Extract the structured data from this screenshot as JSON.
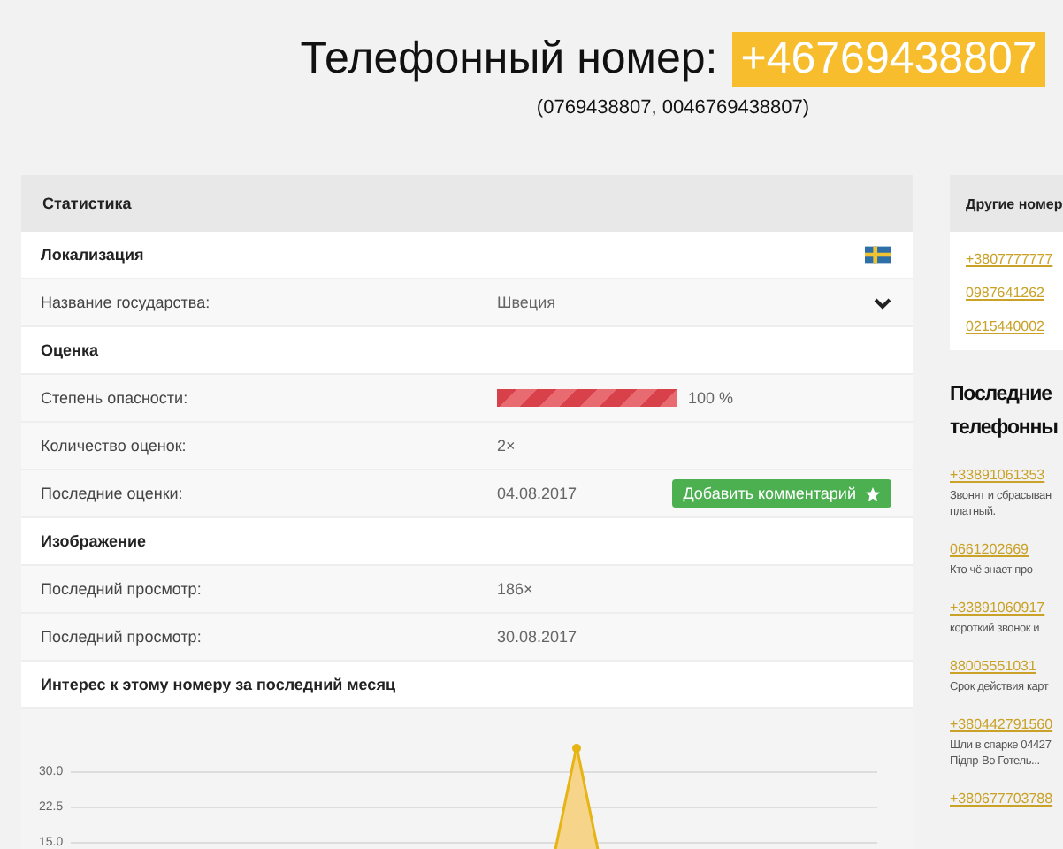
{
  "header": {
    "title": "Телефонный номер:",
    "number": "+46769438807",
    "alternates": "(0769438807, 0046769438807)"
  },
  "stats": {
    "title": "Статистика",
    "rows": [
      {
        "kind": "section",
        "label": "Локализация",
        "flag": true
      },
      {
        "kind": "select",
        "label": "Название государства:",
        "value": "Швеция",
        "expanded": false
      },
      {
        "kind": "section",
        "label": "Оценка"
      },
      {
        "kind": "bar",
        "label": "Степень опасности:",
        "level": 1.0,
        "reading": "100 %"
      },
      {
        "kind": "text",
        "label": "Количество оценок:",
        "value": "2×"
      },
      {
        "kind": "button",
        "label": "Последние оценки:",
        "value": "04.08.2017",
        "button": "Добавить комментарий"
      },
      {
        "kind": "section",
        "label": "Изображение"
      },
      {
        "kind": "text",
        "label": "Последний просмотр:",
        "value": "186×"
      },
      {
        "kind": "text",
        "label": "Последний просмотр:",
        "value": "30.08.2017"
      },
      {
        "kind": "section",
        "label": "Интерес к этому номеру за последний месяц"
      }
    ],
    "chart": {
      "yticks": [
        "30.0",
        "22.5",
        "15.0"
      ]
    }
  },
  "other_numbers": {
    "title": "Другие номер",
    "rows": [
      [
        "+3807777777"
      ],
      [
        "0987641262"
      ],
      [
        "0215440002"
      ]
    ]
  },
  "recent": {
    "title": [
      "Последние",
      "телефонны"
    ],
    "items": [
      {
        "number": "+33891061353",
        "comment": [
          "Звонят и сбрасыван",
          "платный."
        ]
      },
      {
        "number": "0661202669",
        "comment": [
          "Кто чё знает про"
        ]
      },
      {
        "number": "+33891060917",
        "comment": [
          "короткий звонок и"
        ]
      },
      {
        "number": "88005551031",
        "comment": [
          "Срок действия карт"
        ]
      },
      {
        "number": "+380442791560",
        "comment": [
          "Шли в спарке 04427",
          "Підпр-Во Готель..."
        ]
      },
      {
        "number": "+380677703788"
      }
    ]
  }
}
